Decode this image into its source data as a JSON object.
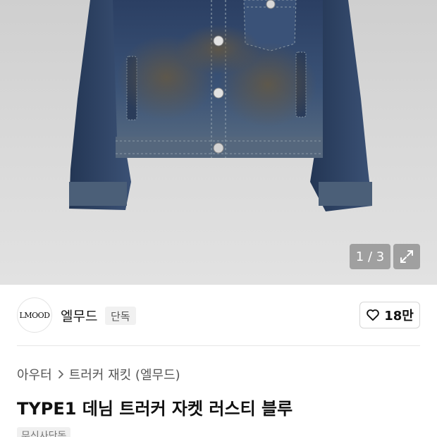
{
  "gallery": {
    "counter": "1 / 3",
    "expand_icon": "expand-icon"
  },
  "brand": {
    "logo_text": "LMOOD",
    "name": "엘무드",
    "badge": "단독"
  },
  "like": {
    "icon": "heart-icon",
    "count": "18만"
  },
  "breadcrumb": {
    "category": "아우터",
    "separator_icon": "chevron-right-icon",
    "subcategory": "트러커 재킷 (엘무드)"
  },
  "product": {
    "title": "TYPE1 데님 트러커 자켓 러스티 블루",
    "tag": "무신사단독"
  }
}
